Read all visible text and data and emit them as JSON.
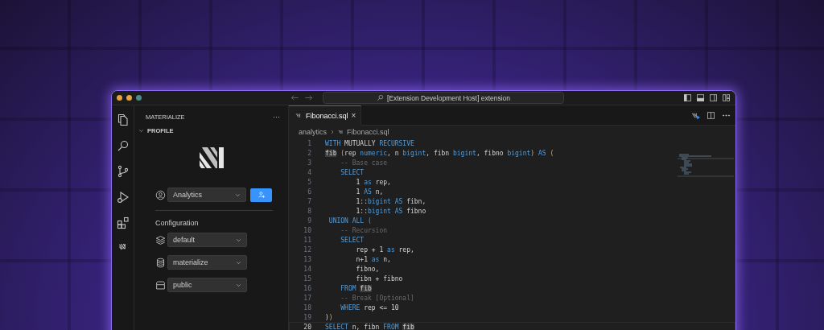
{
  "window": {
    "title": "[Extension Development Host] extension"
  },
  "sidebar": {
    "title": "MATERIALIZE",
    "more": "···",
    "section": {
      "label": "PROFILE",
      "expanded": true
    },
    "profile": {
      "value": "Analytics"
    },
    "configuration": {
      "heading": "Configuration",
      "selects": [
        {
          "kind": "cluster",
          "value": "default"
        },
        {
          "kind": "database",
          "value": "materialize"
        },
        {
          "kind": "schema",
          "value": "public"
        }
      ]
    }
  },
  "editor": {
    "tabs": [
      {
        "label": "Fibonacci.sql",
        "selected": true,
        "close": "×"
      }
    ],
    "breadcrumb": [
      "analytics",
      "Fibonacci.sql"
    ],
    "lines": [
      {
        "number": "1",
        "current": false,
        "tokens": [
          {
            "text": "WITH",
            "kind": "kw"
          },
          {
            "text": " MUTUALLY ",
            "kind": "plain"
          },
          {
            "text": "RECURSIVE",
            "kind": "kw"
          }
        ]
      },
      {
        "number": "2",
        "current": false,
        "tokens": [
          {
            "text": "fib",
            "kind": "hl"
          },
          {
            "text": " (",
            "kind": "bracket"
          },
          {
            "text": "rep ",
            "kind": "plain"
          },
          {
            "text": "numeric",
            "kind": "kw"
          },
          {
            "text": ", n ",
            "kind": "plain"
          },
          {
            "text": "bigint",
            "kind": "kw"
          },
          {
            "text": ", fibn ",
            "kind": "plain"
          },
          {
            "text": "bigint",
            "kind": "kw"
          },
          {
            "text": ", fibno ",
            "kind": "plain"
          },
          {
            "text": "bigint",
            "kind": "kw"
          },
          {
            "text": ")",
            "kind": "bracket"
          },
          {
            "text": " AS ",
            "kind": "kw"
          },
          {
            "text": "(",
            "kind": "bracket"
          }
        ]
      },
      {
        "number": "3",
        "current": false,
        "tokens": [
          {
            "text": "    -- Base case",
            "kind": "comment"
          }
        ]
      },
      {
        "number": "4",
        "current": false,
        "tokens": [
          {
            "text": "    SELECT",
            "kind": "kw"
          }
        ]
      },
      {
        "number": "5",
        "current": false,
        "tokens": [
          {
            "text": "        1 ",
            "kind": "plain"
          },
          {
            "text": "as",
            "kind": "kw"
          },
          {
            "text": " rep,",
            "kind": "plain"
          }
        ]
      },
      {
        "number": "6",
        "current": false,
        "tokens": [
          {
            "text": "        1 ",
            "kind": "plain"
          },
          {
            "text": "AS",
            "kind": "kw"
          },
          {
            "text": " n,",
            "kind": "plain"
          }
        ]
      },
      {
        "number": "7",
        "current": false,
        "tokens": [
          {
            "text": "        1::",
            "kind": "plain"
          },
          {
            "text": "bigint AS",
            "kind": "kw"
          },
          {
            "text": " fibn,",
            "kind": "plain"
          }
        ]
      },
      {
        "number": "8",
        "current": false,
        "tokens": [
          {
            "text": "        1::",
            "kind": "plain"
          },
          {
            "text": "bigint AS",
            "kind": "kw"
          },
          {
            "text": " fibno",
            "kind": "plain"
          }
        ]
      },
      {
        "number": "9",
        "current": false,
        "tokens": [
          {
            "text": " UNION ALL (",
            "kind": "kw"
          }
        ]
      },
      {
        "number": "10",
        "current": false,
        "tokens": [
          {
            "text": "    -- Recursion",
            "kind": "comment"
          }
        ]
      },
      {
        "number": "11",
        "current": false,
        "tokens": [
          {
            "text": "    SELECT",
            "kind": "kw"
          }
        ]
      },
      {
        "number": "12",
        "current": false,
        "tokens": [
          {
            "text": "        rep + 1 ",
            "kind": "plain"
          },
          {
            "text": "as",
            "kind": "kw"
          },
          {
            "text": " rep,",
            "kind": "plain"
          }
        ]
      },
      {
        "number": "13",
        "current": false,
        "tokens": [
          {
            "text": "        n+1 ",
            "kind": "plain"
          },
          {
            "text": "as",
            "kind": "kw"
          },
          {
            "text": " n,",
            "kind": "plain"
          }
        ]
      },
      {
        "number": "14",
        "current": false,
        "tokens": [
          {
            "text": "        fibno,",
            "kind": "plain"
          }
        ]
      },
      {
        "number": "15",
        "current": false,
        "tokens": [
          {
            "text": "        fibn + fibno",
            "kind": "plain"
          }
        ]
      },
      {
        "number": "16",
        "current": false,
        "tokens": [
          {
            "text": "    FROM ",
            "kind": "kw"
          },
          {
            "text": "fib",
            "kind": "hl"
          }
        ]
      },
      {
        "number": "17",
        "current": false,
        "tokens": [
          {
            "text": "    -- Break [Optional]",
            "kind": "comment"
          }
        ]
      },
      {
        "number": "18",
        "current": false,
        "tokens": [
          {
            "text": "    WHERE",
            "kind": "kw"
          },
          {
            "text": " rep <= 10",
            "kind": "plain"
          }
        ]
      },
      {
        "number": "19",
        "current": false,
        "tokens": [
          {
            "text": ")",
            "kind": "plain"
          },
          {
            "text": ")",
            "kind": "bracket"
          }
        ]
      },
      {
        "number": "20",
        "current": true,
        "tokens": [
          {
            "text": "SELECT",
            "kind": "kw"
          },
          {
            "text": " n, fibn ",
            "kind": "plain"
          },
          {
            "text": "FROM ",
            "kind": "kw"
          },
          {
            "text": "fib",
            "kind": "hl"
          }
        ]
      }
    ]
  }
}
